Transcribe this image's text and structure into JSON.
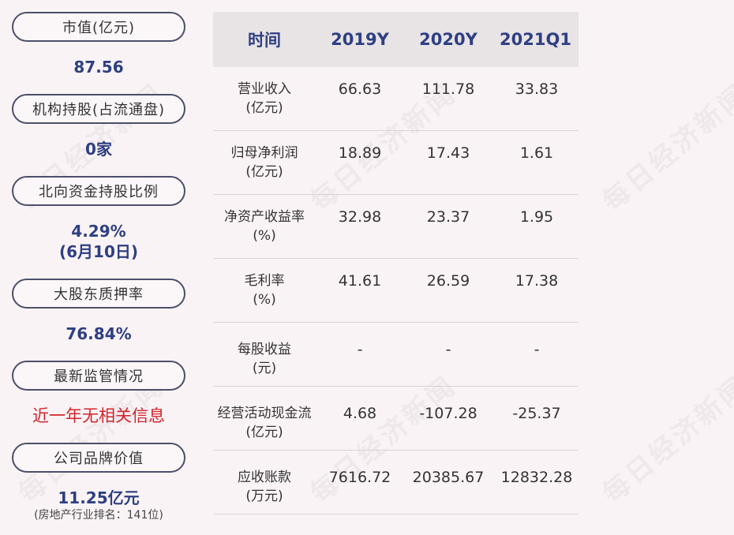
{
  "summary": [
    {
      "label": "市值(亿元)",
      "value": "87.56"
    },
    {
      "label": "机构持股(占流通盘)",
      "value": "0家"
    },
    {
      "label": "北向资金持股比例",
      "value": "4.29%",
      "value2": "(6月10日)"
    },
    {
      "label": "大股东质押率",
      "value": "76.84%"
    },
    {
      "label": "最新监管情况",
      "value": "近一年无相关信息"
    },
    {
      "label": "公司品牌价值",
      "value": "11.25亿元",
      "value2": "(房地产行业排名：141位)"
    }
  ],
  "table": {
    "headers": [
      "时间",
      "2019Y",
      "2020Y",
      "2021Q1"
    ],
    "rows": [
      {
        "label": "营业收入",
        "unit": "(亿元)",
        "values": [
          "66.63",
          "111.78",
          "33.83"
        ]
      },
      {
        "label": "归母净利润",
        "unit": "(亿元)",
        "values": [
          "18.89",
          "17.43",
          "1.61"
        ]
      },
      {
        "label": "净资产收益率",
        "unit": "(%)",
        "values": [
          "32.98",
          "23.37",
          "1.95"
        ]
      },
      {
        "label": "毛利率",
        "unit": "(%)",
        "values": [
          "41.61",
          "26.59",
          "17.38"
        ]
      },
      {
        "label": "每股收益",
        "unit": "(元)",
        "values": [
          "-",
          "-",
          "-"
        ]
      },
      {
        "label": "经营活动现金流",
        "unit": "(亿元)",
        "values": [
          "4.68",
          "-107.28",
          "-25.37"
        ]
      },
      {
        "label": "应收账款",
        "unit": "(万元)",
        "values": [
          "7616.72",
          "20385.67",
          "12832.28"
        ]
      }
    ]
  },
  "watermark": "每日经济新闻",
  "colors": {
    "accent_blue": "#2e3f82",
    "alert_red": "#d3242c",
    "header_bg": "#e8e3e5"
  }
}
